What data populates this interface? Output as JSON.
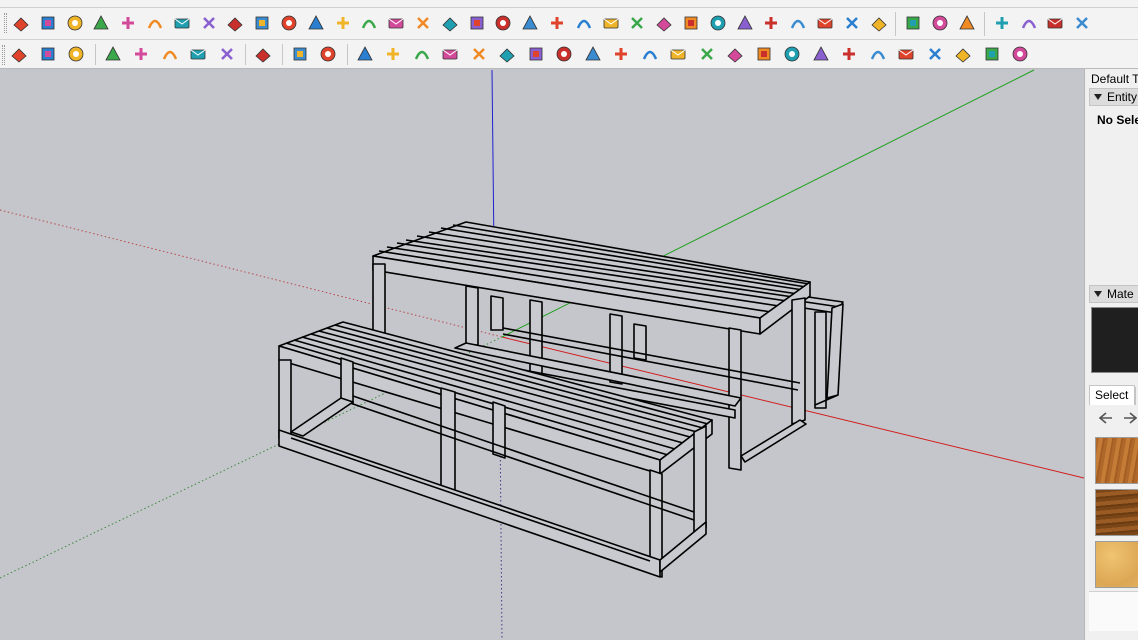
{
  "toolbar": {
    "row1_icons": [
      "iso-view-icon",
      "top-view-icon",
      "front-view-icon",
      "right-view-icon",
      "back-view-icon",
      "left-view-icon",
      "follow-me-icon",
      "paint-icon",
      "section-plane-icon",
      "tag-flag-icon",
      "camera-walk-icon",
      "look-around-icon",
      "offset-icon",
      "curve-icon",
      "add-plus-icon",
      "move-cross-icon",
      "sandbox-cone-icon",
      "triangle-icon",
      "arc-icon",
      "rotate-icon",
      "orbit-icon",
      "move-icon",
      "push-pull-icon",
      "undo-icon",
      "flip-icon",
      "component-icon",
      "bounding-icon",
      "paint-square-icon",
      "image-icon",
      "texture-icon",
      "grid-yellow-icon",
      "grid-orange-icon",
      "grid-gold-icon",
      "dots-red-icon",
      "circle-dots-icon",
      "grid-dots-icon",
      "layers-icon",
      "window-icon",
      "window-filled-icon",
      "window-stack-icon"
    ],
    "row2_icons": [
      "extension-warehouse-icon",
      "refresh-icon",
      "transfer-icon",
      "add-circle-icon",
      "upload-tree-icon",
      "chart-icon",
      "checker-icon",
      "cloud-icon",
      "settings-gear-icon",
      "mail-icon",
      "info-icon",
      "select-box-icon",
      "bezier-icon",
      "bucket-icon",
      "scissors-icon",
      "lasso-icon",
      "spiral-icon",
      "cube-icon",
      "cylinder-icon",
      "corner-icon",
      "corner-2-icon",
      "chain-icon",
      "pipe-icon",
      "bend-icon",
      "stair-icon",
      "grid-wall-icon",
      "hand-icon",
      "soften-icon",
      "fan-icon",
      "merge-icon",
      "split-icon",
      "panel-icon",
      "cut-icon",
      "slot-icon",
      "extrude-icon"
    ]
  },
  "tray": {
    "title": "Default T",
    "entity_header": "Entity",
    "selection_status": "No Sele",
    "materials_header": "Mate",
    "select_tab": "Select",
    "back_arrow": "back-arrow-icon",
    "forward_arrow": "forward-arrow-icon",
    "material_swatches": [
      "wood-light-icon",
      "wood-dark-icon",
      "wood-sand-icon"
    ],
    "colors": {
      "current_material": "#1f1f1f"
    }
  },
  "viewport": {
    "background": "#c5c6cb",
    "axis_colors": {
      "red": "#d11d1d",
      "green": "#1fa11f",
      "blue": "#2020d0"
    },
    "model": "picnic-table-with-benches"
  }
}
